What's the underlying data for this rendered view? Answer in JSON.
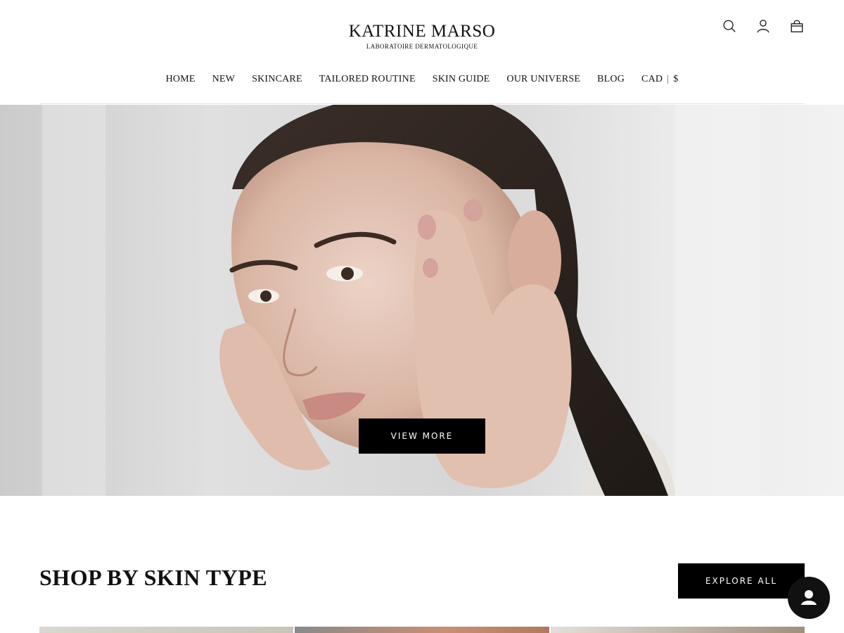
{
  "brand": {
    "name": "KATRINE MARSO",
    "tagline": "LABORATOIRE DERMATOLOGIQUE"
  },
  "header_icons": [
    "search-icon",
    "account-icon",
    "cart-icon"
  ],
  "nav": {
    "items": [
      {
        "label": "HOME"
      },
      {
        "label": "NEW"
      },
      {
        "label": "SKINCARE"
      },
      {
        "label": "TAILORED ROUTINE"
      },
      {
        "label": "SKIN GUIDE"
      },
      {
        "label": "OUR UNIVERSE"
      },
      {
        "label": "BLOG"
      }
    ],
    "currency": {
      "code": "CAD",
      "separator": "|",
      "symbol": "$"
    }
  },
  "hero": {
    "button_label": "VIEW MORE"
  },
  "section": {
    "title": "SHOP BY SKIN TYPE",
    "button_label": "EXPLORE ALL"
  },
  "colors": {
    "primary": "#000000",
    "background": "#ffffff",
    "text": "#111111"
  }
}
